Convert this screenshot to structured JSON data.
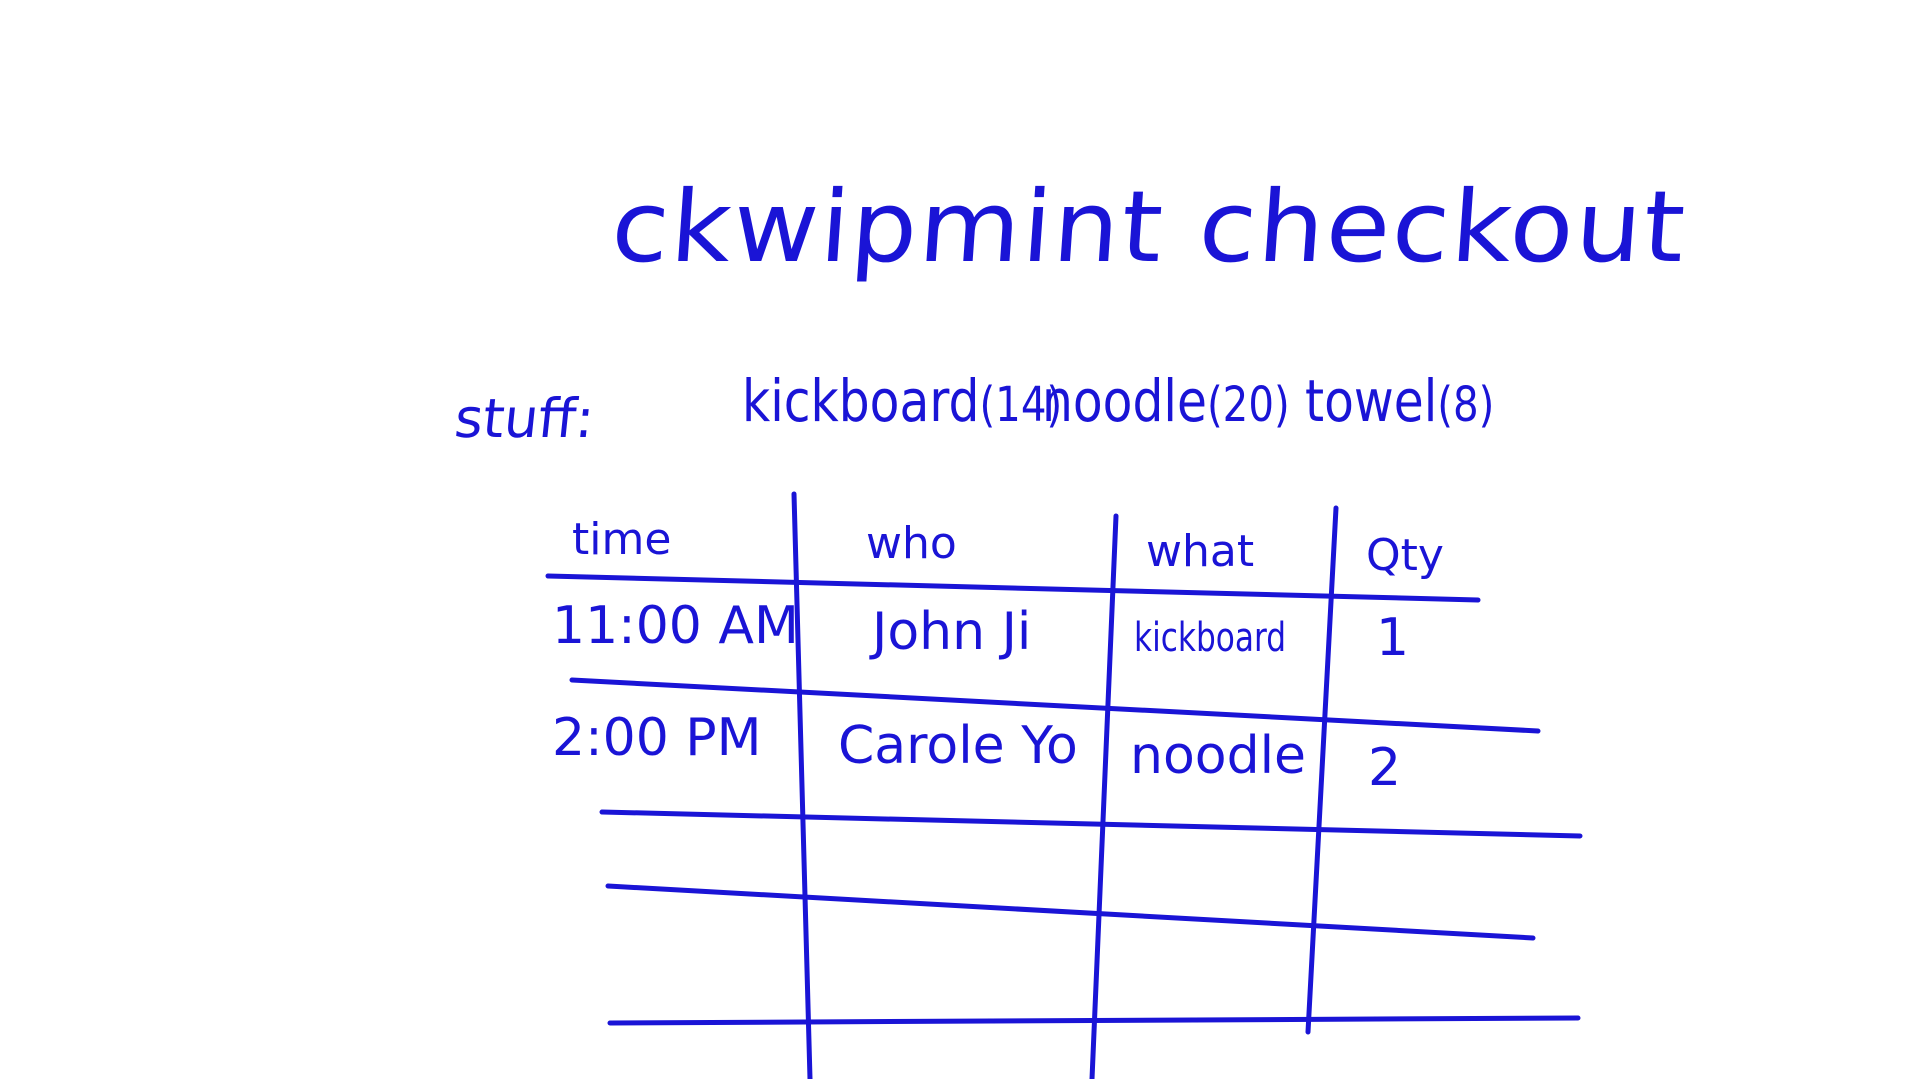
{
  "title": "ckwipmint checkout",
  "stuff": {
    "label": "stuff:",
    "items": [
      {
        "name": "kickboard",
        "count": "(14)"
      },
      {
        "name": "noodle",
        "count": "(20)"
      },
      {
        "name": "towel",
        "count": "(8)"
      }
    ]
  },
  "table": {
    "headers": [
      "time",
      "who",
      "what",
      "Qty"
    ],
    "rows": [
      {
        "time": "11:00 AM",
        "who": "John Ji",
        "what": "kickboard",
        "qty": "1"
      },
      {
        "time": "2:00 PM",
        "who": "Carole Yo",
        "what": "noodle",
        "qty": "2"
      }
    ]
  },
  "ink_color": "#1a14d6",
  "background_color": "#ffffff"
}
